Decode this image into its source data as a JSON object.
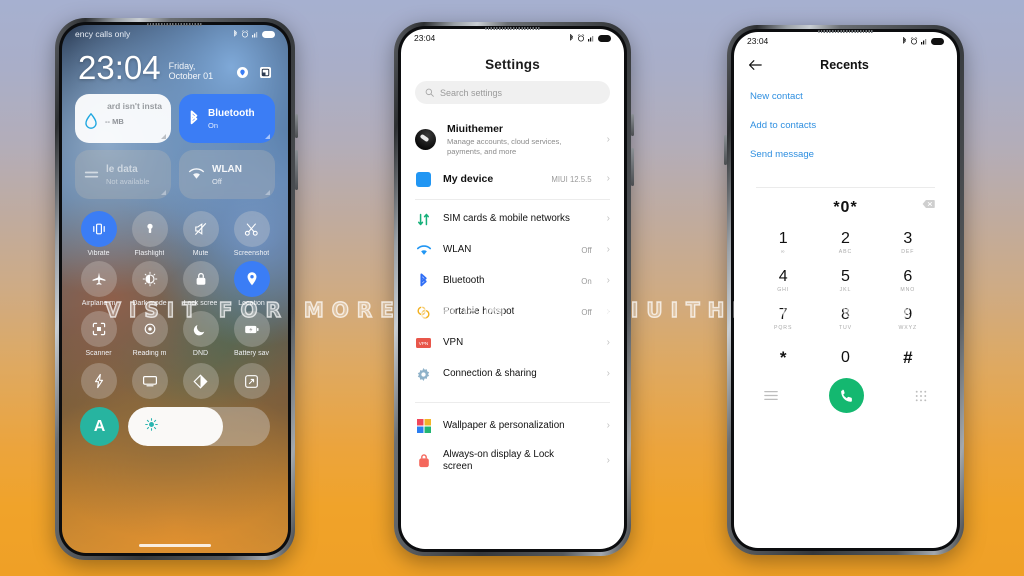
{
  "watermark": {
    "text": "VISIT FOR MORE THEMES - MIUITHEMER.COM"
  },
  "phone1": {
    "status": {
      "carrier": "ency calls only",
      "icons": [
        "bluetooth-icon",
        "alarm-icon",
        "signal-icon",
        "battery-icon"
      ]
    },
    "lockscreen": {
      "time": "23:04",
      "date": "Friday, October 01",
      "shortcut_icons": [
        "flashlight-shortcut-icon",
        "camera-shortcut-icon"
      ]
    },
    "big_cards": [
      {
        "title": "ard isn't insta",
        "sub": "-- MB",
        "icon": "water-drop-icon",
        "style": "white"
      },
      {
        "title": "Bluetooth",
        "sub": "On",
        "icon": "bluetooth-icon",
        "style": "blue"
      },
      {
        "title": "le data",
        "sub": "Not available",
        "icon": "mobile-data-icon",
        "style": "dim"
      },
      {
        "title": "WLAN",
        "sub": "Off",
        "icon": "wifi-icon",
        "style": "dim"
      }
    ],
    "tiles": [
      {
        "label": "Vibrate",
        "icon": "vibrate-icon",
        "active": true
      },
      {
        "label": "Flashlight",
        "icon": "flashlight-icon",
        "active": false
      },
      {
        "label": "Mute",
        "icon": "mute-icon",
        "active": false
      },
      {
        "label": "Screenshot",
        "icon": "scissors-icon",
        "active": false
      },
      {
        "label": "Airplane m",
        "icon": "airplane-icon",
        "active": false
      },
      {
        "label": "Dark mode",
        "icon": "dark-mode-icon",
        "active": false
      },
      {
        "label": "Lock scree",
        "icon": "lock-icon",
        "active": false
      },
      {
        "label": "Location",
        "icon": "location-pin-icon",
        "active": true
      },
      {
        "label": "Scanner",
        "icon": "scanner-icon",
        "active": false
      },
      {
        "label": "Reading m",
        "icon": "reading-mode-icon",
        "active": false
      },
      {
        "label": "DND",
        "icon": "moon-icon",
        "active": false
      },
      {
        "label": "Battery sav",
        "icon": "battery-saver-icon",
        "active": false
      }
    ],
    "tiles_row4": [
      {
        "label": "",
        "icon": "lightning-icon",
        "active": false
      },
      {
        "label": "",
        "icon": "cast-icon",
        "active": false
      },
      {
        "label": "",
        "icon": "contrast-icon",
        "active": false
      },
      {
        "label": "",
        "icon": "fullscreen-icon",
        "active": false
      }
    ],
    "bottom": {
      "auto_label": "A",
      "brightness_icon": "brightness-icon",
      "brightness_percent": 67
    }
  },
  "phone2": {
    "status": {
      "time": "23:04",
      "icons": [
        "bluetooth-icon",
        "alarm-icon",
        "signal-icon",
        "battery-icon"
      ]
    },
    "title": "Settings",
    "search": {
      "placeholder": "Search settings",
      "icon": "search-icon"
    },
    "account": {
      "name": "Miuithemer",
      "sub": "Manage accounts, cloud services, payments, and more",
      "icon": "avatar"
    },
    "device": {
      "title": "My device",
      "value": "MIUI 12.5.5",
      "icon": "device-icon"
    },
    "rows": [
      {
        "title": "SIM cards & mobile networks",
        "value": "",
        "icon": "sim-icon"
      },
      {
        "title": "WLAN",
        "value": "Off",
        "icon": "wifi-icon"
      },
      {
        "title": "Bluetooth",
        "value": "On",
        "icon": "bluetooth-icon"
      },
      {
        "title": "Portable hotspot",
        "value": "Off",
        "icon": "hotspot-icon"
      },
      {
        "title": "VPN",
        "value": "",
        "icon": "vpn-icon"
      },
      {
        "title": "Connection & sharing",
        "value": "",
        "icon": "gear-icon"
      }
    ],
    "rows2": [
      {
        "title": "Wallpaper & personalization",
        "value": "",
        "icon": "wallpaper-icon"
      },
      {
        "title": "Always-on display & Lock screen",
        "value": "",
        "icon": "lock-bag-icon"
      }
    ]
  },
  "phone3": {
    "status": {
      "time": "23:04",
      "icons": [
        "bluetooth-icon",
        "alarm-icon",
        "signal-icon",
        "battery-icon"
      ]
    },
    "title": "Recents",
    "back_icon": "back-arrow-icon",
    "actions": [
      "New contact",
      "Add to contacts",
      "Send message"
    ],
    "number": "*0*",
    "backspace_icon": "backspace-icon",
    "keys": [
      {
        "digit": "1",
        "letters": ""
      },
      {
        "digit": "2",
        "letters": "ABC"
      },
      {
        "digit": "3",
        "letters": "DEF"
      },
      {
        "digit": "4",
        "letters": "GHI"
      },
      {
        "digit": "5",
        "letters": "JKL"
      },
      {
        "digit": "6",
        "letters": "MNO"
      },
      {
        "digit": "7",
        "letters": "PQRS"
      },
      {
        "digit": "8",
        "letters": "TUV"
      },
      {
        "digit": "9",
        "letters": "WXYZ"
      },
      {
        "digit": "*",
        "letters": ""
      },
      {
        "digit": "0",
        "letters": ""
      },
      {
        "digit": "#",
        "letters": ""
      }
    ],
    "bottom": {
      "menu_icon": "menu-icon",
      "call_icon": "call-icon",
      "keypad_icon": "keypad-icon",
      "call_color": "#14b870"
    }
  },
  "colors": {
    "accent_blue": "#3b7df5",
    "link_blue": "#2f8fe0",
    "call_green": "#14b870",
    "bg_top": "#a6b0d0",
    "bg_bottom": "#efa026"
  }
}
